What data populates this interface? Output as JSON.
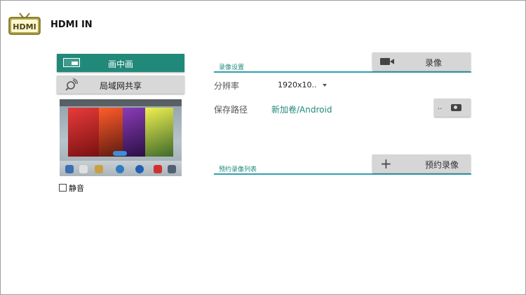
{
  "header": {
    "title": "HDMI IN",
    "logo_icon": "hdmi-tv-logo-icon",
    "logo_text": "HDMI"
  },
  "left_panel": {
    "pip_button": {
      "label": "画中画",
      "icon": "pip-icon"
    },
    "lan_share_button": {
      "label": "局域网共享",
      "icon": "lan-share-icon"
    },
    "preview": {
      "icon": "video-preview"
    },
    "mute": {
      "label": "静音",
      "checked": false
    }
  },
  "record_settings": {
    "section_title": "录像设置",
    "record_button": {
      "label": "录像",
      "icon": "camcorder-icon"
    },
    "resolution": {
      "label": "分辨率",
      "value": "1920x10.."
    },
    "save_path": {
      "label": "保存路径",
      "value": "新加卷/Android"
    },
    "folder_button": {
      "label": "..",
      "icon": "camera-icon"
    }
  },
  "schedule": {
    "section_title": "预约录像列表",
    "schedule_button": {
      "label": "预约录像",
      "icon": "plus-icon"
    }
  },
  "colors": {
    "accent": "#21897a",
    "divider": "#2f9fb0",
    "button_gray": "#d6d6d6"
  }
}
